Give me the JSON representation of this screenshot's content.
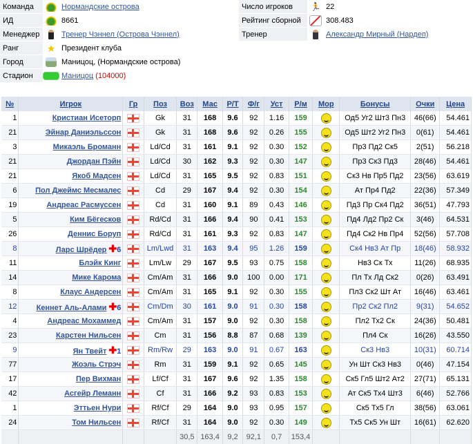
{
  "info_left": [
    {
      "label": "Команда",
      "icon": "team-icon",
      "value": "Нормандские острова",
      "link": true
    },
    {
      "label": "ИД",
      "icon": "id-icon",
      "value": "8661",
      "link": false
    },
    {
      "label": "Менеджер",
      "icon": "manager-icon",
      "value": "Тренер Чэннел (Острова Чэннел)",
      "link": true
    },
    {
      "label": "Ранг",
      "icon": "star-icon",
      "value": "Президент клуба",
      "link": false
    },
    {
      "label": "Город",
      "icon": "city-icon",
      "value": "Маницоц, (Нормандские острова)",
      "link": false
    },
    {
      "label": "Стадион",
      "icon": "stadium-icon",
      "value": "Маницоц",
      "extra": "(104000)",
      "link": true
    }
  ],
  "info_right": [
    {
      "label": "Число игроков",
      "icon": "runner-icon",
      "value": "22",
      "link": false
    },
    {
      "label": "Рейтинг сборной",
      "icon": "chart-icon",
      "value": "308.483",
      "link": false
    },
    {
      "label": "Тренер",
      "icon": "coach-icon",
      "value": "Александр Мирный (Нардеп)",
      "link": true
    }
  ],
  "columns": [
    "№",
    "Игрок",
    "Гр",
    "Поз",
    "Воз",
    "Мас",
    "Р/Т",
    "Ф/г",
    "Уст",
    "Р/м",
    "Мор",
    "Бонусы",
    "Очки",
    "Цена"
  ],
  "players": [
    {
      "num": "1",
      "name": "Кристиан Исеторп",
      "pos": "Gk",
      "age": "31",
      "mas": "168",
      "rt": "9.6",
      "fg": "92",
      "ust": "1.16",
      "rm": "159",
      "bonus": "Од5 Уг2 Шт3 Пн3",
      "pts": "46(66)",
      "price": "54.461"
    },
    {
      "num": "21",
      "name": "Эйнар Даниэльссон",
      "pos": "Gk",
      "age": "31",
      "mas": "168",
      "rt": "9.6",
      "fg": "92",
      "ust": "0.26",
      "rm": "155",
      "bonus": "Од5 Шт2 Уг2 Пн3",
      "pts": "0(61)",
      "price": "54.461"
    },
    {
      "num": "3",
      "name": "Микаэль Броманн",
      "pos": "Ld/Cd",
      "age": "31",
      "mas": "161",
      "rt": "9.1",
      "fg": "92",
      "ust": "0.30",
      "rm": "152",
      "bonus": "Пр3 Пд2 Ск5",
      "pts": "2(51)",
      "price": "56.218"
    },
    {
      "num": "21",
      "name": "Джордан Пэйн",
      "pos": "Ld/Cd",
      "age": "30",
      "mas": "162",
      "rt": "9.3",
      "fg": "92",
      "ust": "0.30",
      "rm": "147",
      "bonus": "Пр3 Ск3 Пд3",
      "pts": "28(46)",
      "price": "54.461"
    },
    {
      "num": "21",
      "name": "Якоб Мадсен",
      "pos": "Ld/Cd",
      "age": "31",
      "mas": "165",
      "rt": "9.5",
      "fg": "92",
      "ust": "0.83",
      "rm": "151",
      "bonus": "Ск3 Нв Пр5 Пд2",
      "pts": "23(56)",
      "price": "63.619"
    },
    {
      "num": "6",
      "name": "Пол Джеймс Месмалес",
      "pos": "Cd",
      "age": "29",
      "mas": "167",
      "rt": "9.4",
      "fg": "92",
      "ust": "0.30",
      "rm": "154",
      "bonus": "Ат Пр4 Пд2",
      "pts": "22(36)",
      "price": "57.349"
    },
    {
      "num": "19",
      "name": "Андреас Расмуссен",
      "pos": "Cd",
      "age": "31",
      "mas": "160",
      "rt": "9.1",
      "fg": "89",
      "ust": "0.43",
      "rm": "146",
      "bonus": "Пд3 Пр Ск4 Пд2",
      "pts": "36(51)",
      "price": "47.793"
    },
    {
      "num": "5",
      "name": "Ким Бёгесков",
      "pos": "Rd/Cd",
      "age": "31",
      "mas": "166",
      "rt": "9.4",
      "fg": "90",
      "ust": "0.41",
      "rm": "153",
      "bonus": "Пд4 Лд2 Пр2 Ск",
      "pts": "3(46)",
      "price": "64.531"
    },
    {
      "num": "26",
      "name": "Деннис Боруп",
      "pos": "Rd/Cd",
      "age": "31",
      "mas": "161",
      "rt": "9.3",
      "fg": "92",
      "ust": "0.83",
      "rm": "147",
      "bonus": "Пд4 Ск2 Нв Пр4",
      "pts": "52(56)",
      "price": "57.708"
    },
    {
      "num": "8",
      "name": "Ларс Шрёдер",
      "injury": "6",
      "blue": true,
      "pos": "Lm/Lwd",
      "age": "31",
      "mas": "163",
      "rt": "9.4",
      "fg": "95",
      "ust": "1.26",
      "rm": "159",
      "bonus": "Ск4 Нв3 Ат Пр",
      "pts": "18(46)",
      "price": "58.932"
    },
    {
      "num": "11",
      "name": "Блэйк Кинг",
      "pos": "Lm/Lw",
      "age": "29",
      "mas": "167",
      "rt": "9.5",
      "fg": "93",
      "ust": "0.75",
      "rm": "158",
      "bonus": "Нв3 Ск Тх",
      "pts": "11(26)",
      "price": "68.935"
    },
    {
      "num": "14",
      "name": "Мике Карома",
      "pos": "Cm/Am",
      "age": "31",
      "mas": "166",
      "rt": "9.0",
      "fg": "100",
      "ust": "0.00",
      "rm": "171",
      "bonus": "Пл Тх Лд Ск2",
      "pts": "0(26)",
      "price": "63.491"
    },
    {
      "num": "8",
      "name": "Клаус Андерсен",
      "pos": "Cm/Am",
      "age": "31",
      "mas": "165",
      "rt": "9.1",
      "fg": "92",
      "ust": "0.30",
      "rm": "155",
      "bonus": "Пл3 Ск2 Шт Ат",
      "pts": "16(46)",
      "price": "63.461"
    },
    {
      "num": "12",
      "name": "Кеннет Аль-Алами",
      "injury": "6",
      "blue": true,
      "pos": "Cm/Dm",
      "age": "30",
      "mas": "161",
      "rt": "9.0",
      "fg": "91",
      "ust": "0.30",
      "rm": "158",
      "bonus": "Пр2 Ск2 Пл2",
      "pts": "9(31)",
      "price": "54.652"
    },
    {
      "num": "4",
      "name": "Андреас Мохаммед",
      "pos": "Cm/Am",
      "age": "31",
      "mas": "157",
      "rot": "",
      "rt": "9.0",
      "fg": "92",
      "ust": "0.30",
      "rm": "158",
      "bonus": "Пл2 Тх2 Ск",
      "pts": "24(36)",
      "price": "50.481"
    },
    {
      "num": "23",
      "name": "Карстен Нильсен",
      "pos": "Cm",
      "age": "31",
      "mas": "156",
      "rt": "8.8",
      "fg": "87",
      "ust": "0.68",
      "rm": "139",
      "bonus": "Пл4 Ск",
      "pts": "16(26)",
      "price": "43.550"
    },
    {
      "num": "9",
      "name": "Ян Твейт",
      "injury": "1",
      "blue": true,
      "pos": "Rm/Rw",
      "age": "29",
      "mas": "163",
      "rt": "9.0",
      "fg": "91",
      "ust": "0.67",
      "rm": "163",
      "bonus": "Ск3 Нв3",
      "pts": "10(31)",
      "price": "60.714"
    },
    {
      "num": "77",
      "name": "Жоэль Стрэч",
      "pos": "Rm",
      "age": "31",
      "mas": "159",
      "rt": "9.1",
      "fg": "92",
      "ust": "0.65",
      "rm": "145",
      "bonus": "Ун Шт Ск3 Нв3",
      "pts": "0(46)",
      "price": "47.154"
    },
    {
      "num": "17",
      "name": "Пер Вихман",
      "pos": "Lf/Cf",
      "age": "31",
      "mas": "167",
      "rt": "9.6",
      "fg": "92",
      "ust": "1.35",
      "rm": "158",
      "bonus": "Ск5 Гл5 Шт2 Ат2",
      "pts": "27(71)",
      "price": "65.131"
    },
    {
      "num": "42",
      "name": "Асгейр Леманн",
      "pos": "Cf",
      "age": "31",
      "mas": "166",
      "rt": "9.2",
      "fg": "93",
      "ust": "0.83",
      "rm": "153",
      "bonus": "Ат Ск5 Тх4 Шт3",
      "pts": "6(46)",
      "price": "52.766"
    },
    {
      "num": "1",
      "name": "Эттьен Нури",
      "pos": "Rf/Cf",
      "age": "29",
      "mas": "164",
      "rt": "9.0",
      "fg": "93",
      "ust": "0.95",
      "rm": "157",
      "bonus": "Ск5 Тх5 Гл",
      "pts": "38(56)",
      "price": "63.061"
    },
    {
      "num": "24",
      "name": "Том Нильсен",
      "pos": "Rf/Cf",
      "age": "31",
      "mas": "164",
      "rt": "9.0",
      "fg": "92",
      "ust": "0.30",
      "rm": "149",
      "bonus": "Тх5 Ск5 Ун Шт",
      "pts": "16(61)",
      "price": "62.620"
    }
  ],
  "totals": {
    "age": "30,5",
    "mas": "163,4",
    "rt": "9,2",
    "fg": "92,1",
    "ust": "0,7",
    "rm": "153,4"
  }
}
